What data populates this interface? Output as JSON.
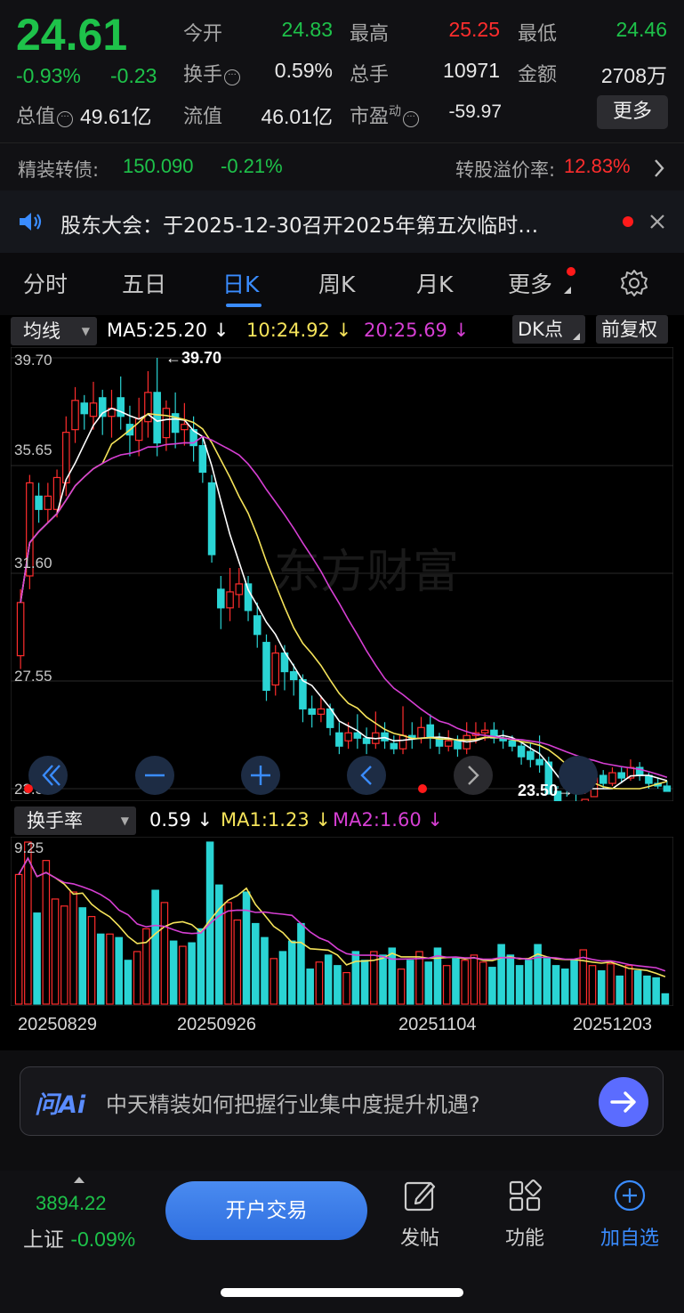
{
  "quote": {
    "price": "24.61",
    "change_pct": "-0.93%",
    "change": "-0.23",
    "open_label": "今开",
    "open": "24.83",
    "high_label": "最高",
    "high": "25.25",
    "low_label": "最低",
    "low": "24.46",
    "turnover_label": "换手",
    "turnover": "0.59%",
    "volume_label": "总手",
    "volume": "10971",
    "amount_label": "金额",
    "amount": "2708万",
    "mktcap_label": "总值",
    "mktcap": "49.61亿",
    "float_label": "流值",
    "float": "46.01亿",
    "pe_label": "市盈",
    "pe_sup": "动",
    "pe": "-59.97",
    "more_label": "更多"
  },
  "bond": {
    "label": "精装转债:",
    "price": "150.090",
    "change": "-0.21%",
    "premium_label": "转股溢价率:",
    "premium": "12.83%"
  },
  "notice": {
    "text": "股东大会：于2025-12-30召开2025年第五次临时…"
  },
  "tabs": [
    "分时",
    "五日",
    "日K",
    "周K",
    "月K",
    "更多"
  ],
  "ma": {
    "selector": "均线",
    "ma5": "MA5:25.20",
    "ma10": "10:24.92",
    "ma20": "20:25.69",
    "dk": "DK点",
    "adjust": "前复权"
  },
  "kline_labels": {
    "y_top": "39.70",
    "y2": "35.65",
    "y3": "31.60",
    "y4": "27.55",
    "y_bottom": "23.50",
    "max_mark": "←39.70",
    "min_mark": "23.50→"
  },
  "volume_row": {
    "selector": "换手率",
    "value": "0.59",
    "ma1": "MA1:1.23",
    "ma2": "MA2:1.60",
    "y_top": "9.25"
  },
  "dates": [
    "20250829",
    "20250926",
    "20251104",
    "20251203"
  ],
  "ai": {
    "logo": "问Ai",
    "prompt": "中天精装如何把握行业集中度提升机遇?"
  },
  "bottom": {
    "index_value": "3894.22",
    "index_name": "上证",
    "index_change": "-0.09%",
    "trade_label": "开户交易",
    "nav": [
      "发帖",
      "功能",
      "加自选"
    ]
  },
  "colors": {
    "up": "#ff2d2d",
    "down": "#1ec24a",
    "flat_down_bar": "#2ad4d4",
    "ma5": "#ffffff",
    "ma10": "#f5e35a",
    "ma20": "#d63fd3",
    "accent": "#3a8cff"
  },
  "chart_data": [
    {
      "type": "candlestick",
      "title": "",
      "ylim": [
        23.5,
        39.7
      ],
      "y_ticks": [
        39.7,
        35.65,
        31.6,
        27.55,
        23.5
      ],
      "candles": [
        [
          28.5,
          30.5,
          28.0,
          31.0
        ],
        [
          31.5,
          35.0,
          31.0,
          35.3
        ],
        [
          34.5,
          34.0,
          33.5,
          35.0
        ],
        [
          34.0,
          34.5,
          33.5,
          35.0
        ],
        [
          34.0,
          35.2,
          33.7,
          35.5
        ],
        [
          35.0,
          36.9,
          34.5,
          37.5
        ],
        [
          37.0,
          38.1,
          36.5,
          38.6
        ],
        [
          38.0,
          37.6,
          37.0,
          38.3
        ],
        [
          37.5,
          38.0,
          37.0,
          38.8
        ],
        [
          38.2,
          37.5,
          36.8,
          38.5
        ],
        [
          37.5,
          37.8,
          36.7,
          38.5
        ],
        [
          38.2,
          37.5,
          37.0,
          39.0
        ],
        [
          37.2,
          36.8,
          36.0,
          37.9
        ],
        [
          36.6,
          37.4,
          36.0,
          38.2
        ],
        [
          37.3,
          38.4,
          36.7,
          39.2
        ],
        [
          38.4,
          36.5,
          36.0,
          39.7
        ],
        [
          36.7,
          37.8,
          36.2,
          38.1
        ],
        [
          37.6,
          36.9,
          36.3,
          38.4
        ],
        [
          37.0,
          37.2,
          36.4,
          38.0
        ],
        [
          37.0,
          36.4,
          35.8,
          37.5
        ],
        [
          36.4,
          35.4,
          35.0,
          36.7
        ],
        [
          35.0,
          32.3,
          32.0,
          35.3
        ],
        [
          31.0,
          30.3,
          29.5,
          31.5
        ],
        [
          30.3,
          30.9,
          29.8,
          31.8
        ],
        [
          30.8,
          31.2,
          30.3,
          31.8
        ],
        [
          31.2,
          30.2,
          29.8,
          31.5
        ],
        [
          30.0,
          29.3,
          28.8,
          30.5
        ],
        [
          29.0,
          27.2,
          26.8,
          29.3
        ],
        [
          27.4,
          28.6,
          27.0,
          28.9
        ],
        [
          28.6,
          27.9,
          27.2,
          28.9
        ],
        [
          27.9,
          27.6,
          27.0,
          28.2
        ],
        [
          27.6,
          26.5,
          26.0,
          27.8
        ],
        [
          26.5,
          26.3,
          25.8,
          27.0
        ],
        [
          26.3,
          26.5,
          26.0,
          27.0
        ],
        [
          26.5,
          25.8,
          25.5,
          26.7
        ],
        [
          25.6,
          25.1,
          24.8,
          26.0
        ],
        [
          25.3,
          25.6,
          25.0,
          26.0
        ],
        [
          25.6,
          25.4,
          25.0,
          26.3
        ],
        [
          25.4,
          25.2,
          24.8,
          25.8
        ],
        [
          25.2,
          25.6,
          25.0,
          26.4
        ],
        [
          25.6,
          25.3,
          25.0,
          26.0
        ],
        [
          25.2,
          25.0,
          24.8,
          25.5
        ],
        [
          25.0,
          25.5,
          24.8,
          26.6
        ],
        [
          25.5,
          25.4,
          25.0,
          26.0
        ],
        [
          25.4,
          25.8,
          25.2,
          26.2
        ],
        [
          25.9,
          25.4,
          25.0,
          26.3
        ],
        [
          25.4,
          25.1,
          24.8,
          25.6
        ],
        [
          25.1,
          25.3,
          24.9,
          25.7
        ],
        [
          25.3,
          25.0,
          24.7,
          25.5
        ],
        [
          25.0,
          25.5,
          24.8,
          26.0
        ],
        [
          25.5,
          25.6,
          25.2,
          26.0
        ],
        [
          25.6,
          25.7,
          25.3,
          26.0
        ],
        [
          25.7,
          25.4,
          25.2,
          26.0
        ],
        [
          25.4,
          25.3,
          25.0,
          25.7
        ],
        [
          25.3,
          25.1,
          24.9,
          25.5
        ],
        [
          25.1,
          24.7,
          24.4,
          25.3
        ],
        [
          24.9,
          24.6,
          24.3,
          25.2
        ],
        [
          24.6,
          24.4,
          24.1,
          25.5
        ],
        [
          24.5,
          23.3,
          23.1,
          24.7
        ],
        [
          23.4,
          22.9,
          22.6,
          23.6
        ],
        [
          22.9,
          22.6,
          22.4,
          23.2
        ],
        [
          22.6,
          22.5,
          22.3,
          22.9
        ],
        [
          22.4,
          23.1,
          22.3,
          23.3
        ],
        [
          23.2,
          23.9,
          23.0,
          24.1
        ],
        [
          24.0,
          23.7,
          23.5,
          24.2
        ],
        [
          23.7,
          24.1,
          23.6,
          24.3
        ],
        [
          24.1,
          23.9,
          23.7,
          24.3
        ],
        [
          23.9,
          24.3,
          23.8,
          24.6
        ],
        [
          24.3,
          24.0,
          23.8,
          24.5
        ],
        [
          24.0,
          23.7,
          23.4,
          24.1
        ],
        [
          23.7,
          23.6,
          23.4,
          23.9
        ],
        [
          23.6,
          23.4,
          23.2,
          23.8
        ]
      ]
    },
    {
      "type": "bar",
      "title": "换手率",
      "ylim": [
        0,
        9.25
      ],
      "values": [
        7.4,
        9.25,
        5.2,
        8.2,
        6.0,
        5.6,
        6.4,
        5.5,
        5.0,
        4.0,
        4.0,
        3.8,
        2.5,
        3.0,
        4.3,
        6.5,
        5.8,
        3.6,
        3.3,
        3.5,
        4.3,
        9.25,
        6.8,
        5.8,
        4.8,
        6.4,
        4.6,
        3.8,
        2.6,
        3.0,
        3.6,
        4.6,
        2.0,
        2.4,
        2.8,
        2.2,
        1.8,
        3.0,
        2.5,
        3.0,
        2.8,
        3.2,
        2.0,
        2.5,
        3.0,
        2.4,
        3.2,
        2.2,
        2.6,
        2.5,
        2.8,
        2.4,
        2.1,
        3.4,
        2.8,
        2.2,
        2.5,
        3.4,
        2.6,
        2.2,
        2.0,
        2.5,
        3.1,
        2.2,
        1.9,
        2.3,
        1.6,
        2.2,
        1.9,
        1.6,
        1.5,
        0.59
      ]
    }
  ]
}
